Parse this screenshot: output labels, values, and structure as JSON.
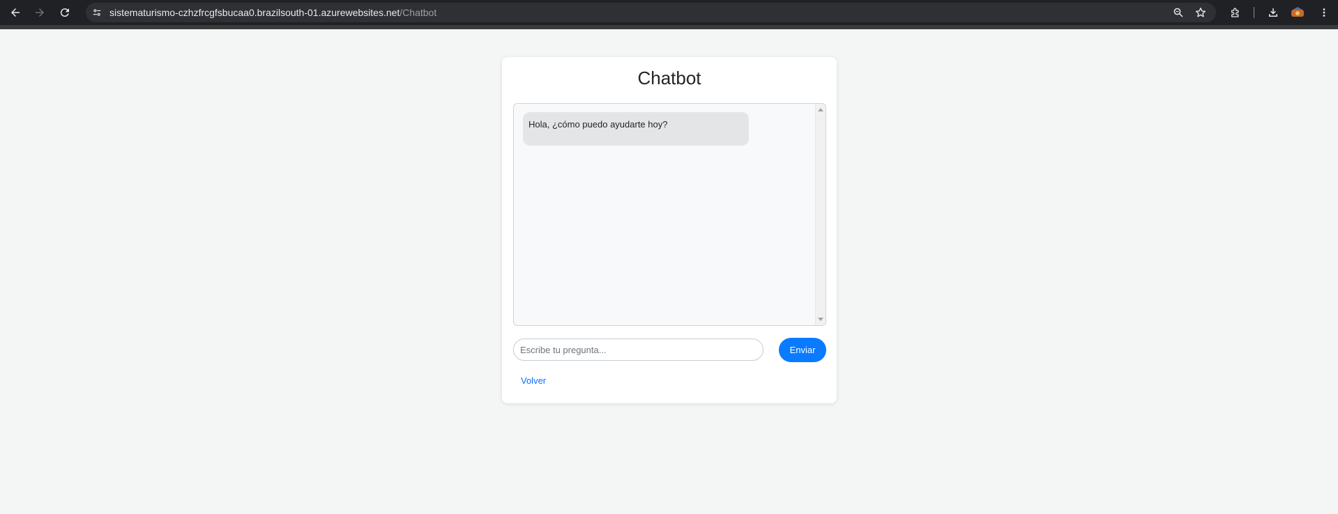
{
  "browser": {
    "url_host": "sistematurismo-czhzfrcgfsbucaa0.brazilsouth-01.azurewebsites.net",
    "url_path": "/Chatbot",
    "icons": [
      "back-arrow-icon",
      "forward-arrow-icon",
      "reload-icon",
      "site-info-icon",
      "zoom-icon",
      "bookmark-star-icon",
      "extensions-icon",
      "download-icon",
      "profile-avatar-icon",
      "more-menu-icon"
    ]
  },
  "page": {
    "title": "Chatbot",
    "messages": [
      {
        "sender": "bot",
        "text": "Hola, ¿cómo puedo ayudarte hoy?"
      }
    ],
    "input_placeholder": "Escribe tu pregunta...",
    "input_value": "",
    "send_label": "Enviar",
    "back_label": "Volver"
  },
  "colors": {
    "page_bg": "#f4f5f5",
    "accent": "#0a7bff",
    "link": "#0d6efd",
    "bubble_bg": "#e4e5e7",
    "chrome_bg": "#202124"
  }
}
